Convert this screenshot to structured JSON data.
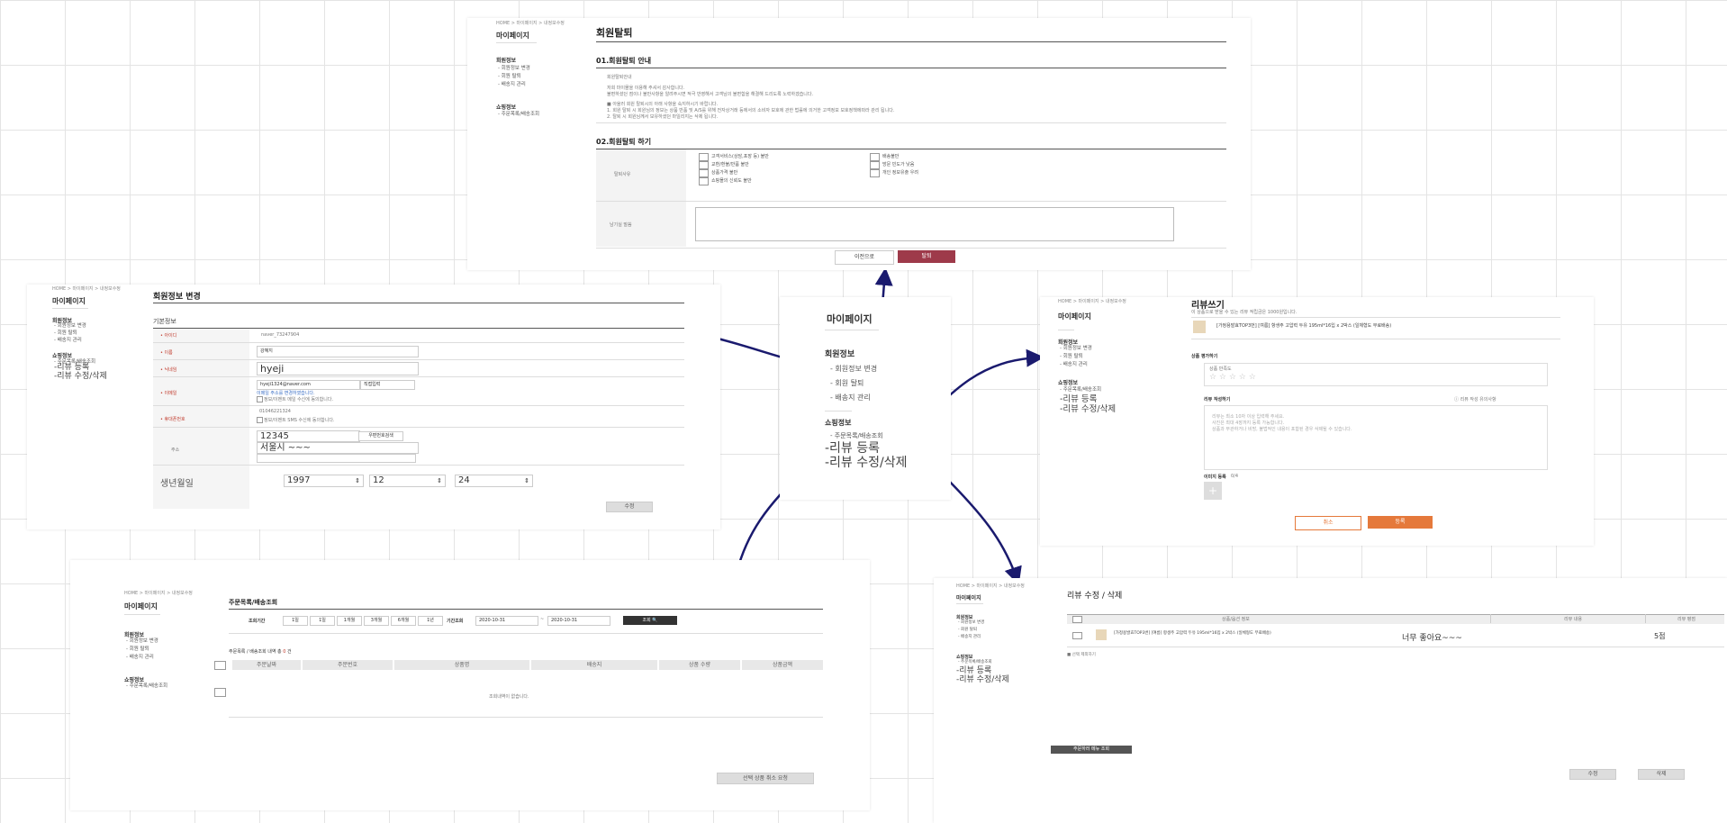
{
  "colors": {
    "arrow": "#1a1a6e",
    "withdraw_button": "#9e3a4a",
    "review_submit_button": "#e5793b",
    "grid": "#e4e4e4"
  },
  "common": {
    "breadcrumb": "HOME > 마이페이지 > 내정보수정",
    "mypage_title": "마이페이지",
    "member_info": "회원정보",
    "edit_info": "- 회원정보 변경",
    "withdraw": "- 회원 탈퇴",
    "address_mgmt": "- 배송지 관리",
    "shopping_info": "쇼핑정보",
    "order_lookup": "- 주문목록/배송조회",
    "review_register": "-리뷰 등록",
    "review_edit_delete": "-리뷰 수정/삭제"
  },
  "center_menu": {
    "title": "마이페이지",
    "member_info": "회원정보",
    "items": [
      "- 회원정보 변경",
      "- 회원 탈퇴",
      "- 배송지 관리"
    ],
    "shopping_info": "쇼핑정보",
    "order_lookup": "- 주문목록/배송조회",
    "review_register": "-리뷰 등록",
    "review_edit_delete": "-리뷰 수정/삭제"
  },
  "withdraw_page": {
    "title": "회원탈퇴",
    "section1": "01.회원탈퇴 안내",
    "guide_label": "회원탈퇴안내",
    "guide_line1": "저희 마이몰을 이용해 주셔서 감사합니다.",
    "guide_line2": "불편하셨던 점이나 불만사항을 알려주시면 적극 반영해서 고객님의 불편함을 해결해 드리도록 노력하겠습니다.",
    "notice_title": "■ 아울러 회원 탈퇴시의 아래 사항을 숙지하시기 바랍니다.",
    "notice_line1": "1. 회원 탈퇴 시 회원님의 정보는 상품 반품 및 A/S를 위해 전자상거래 등에서의 소비자 보호에 관한 법률에 의거한 고객정보 보호정책에따라 관리 됩니다.",
    "notice_line2": "2. 탈퇴 시 회원님께서 보유하셨던 마일리지는 삭제 됩니다.",
    "section2": "02.회원탈퇴 하기",
    "reason_label": "탈퇴사유",
    "reasons_left": [
      "고객서비스(상담,포장 등) 불만",
      "교환/환불/반품 불만",
      "상품가격 불만",
      "쇼핑몰의 신뢰도 불만"
    ],
    "reasons_right": [
      "배송불만",
      "방문 빈도가 낮음",
      "개인 정보유출 우려"
    ],
    "message_label": "남기실 말씀",
    "prev_button": "이전으로",
    "withdraw_button": "탈퇴"
  },
  "edit_page": {
    "title": "회원정보 변경",
    "basic_info": "기본정보",
    "rows": [
      {
        "label": "• 아이디",
        "value": "naver_73247904"
      },
      {
        "label": "• 이름",
        "value": "강혜지"
      },
      {
        "label": "• 닉네임",
        "value": "hyeji"
      },
      {
        "label": "• 이메일",
        "value": "hyeji1324@naver.com"
      },
      {
        "label": "• 휴대폰번호",
        "value": "01046221324"
      },
      {
        "label": "주소",
        "value": "12345"
      }
    ],
    "email_select": "직접입력",
    "email_note": "이메일 주소를 변경하였습니다.",
    "email_agree": "정보/이벤트 메일 수신에 동의합니다.",
    "sms_agree": "정보/이벤트 SMS 수신에 동의합니다.",
    "zip_button": "우편번호검색",
    "address_line": "서울시 ~~~",
    "birth_label": "생년월일",
    "birth_year": "1997",
    "birth_month": "12",
    "birth_day": "24",
    "save_button": "수정"
  },
  "review_write_page": {
    "title": "리뷰쓰기",
    "subtitle": "이 상품으로 받을 수 있는 리뷰 적립금은 1000원입니다.",
    "product": "[가정용발효TOP3번] [여름] 항생주 고압력 두유 195ml*16입 x 2박스 (일체형도 무료배송)",
    "rating_section": "상품 평가하기",
    "rating_label": "상품 만족도",
    "stars": "☆ ☆ ☆ ☆ ☆",
    "write_section": "리뷰 작성하기",
    "write_note": "ⓘ 리뷰 작성 유의사항",
    "placeholder1": "리뷰는 최소 10자 이상 입력해 주세요.",
    "placeholder2": "사진은 최대 4장까지 등록 가능합니다.",
    "placeholder3": "상품과 무관하거나 비방, 불법적인 내용이 포함된 경우 삭제될 수 있습니다.",
    "image_section": "이미지 등록",
    "image_count": "0/4",
    "cancel_button": "취소",
    "submit_button": "등록"
  },
  "order_page": {
    "title": "주문목록/배송조회",
    "period_label": "조회기간",
    "periods": [
      "1일",
      "1일",
      "1개월",
      "3개월",
      "6개월",
      "1년",
      "기간조회"
    ],
    "date_from": "2020-10-31",
    "date_to": "2020-10-31",
    "search_button": "조회 🔍",
    "result_label": "주문목록 / 배송조회 내역 총",
    "result_count": "0",
    "result_suffix": "건",
    "columns": [
      "주문날짜",
      "주문번호",
      "상품명",
      "배송지",
      "상품 수량",
      "상품금액"
    ],
    "empty": "조회내역이 없습니다.",
    "cancel_button": "선택 상품 취소 요청"
  },
  "review_edit_page": {
    "title": "리뷰 수정 / 삭제",
    "columns": [
      "상품/옵션 정보",
      "리뷰 내용",
      "리뷰 평점"
    ],
    "product": "[가정용발효TOP3번] [여름] 항생주 고압력 두유 195ml*16입 x 2박스 (일체형도 무료배송)",
    "review": "너무 좋아요~~~",
    "score": "5점",
    "select_all": "■ 선택 제외하기",
    "top_button": "주문하러 메뉴 조회",
    "edit_button": "수정",
    "delete_button": "삭제"
  }
}
